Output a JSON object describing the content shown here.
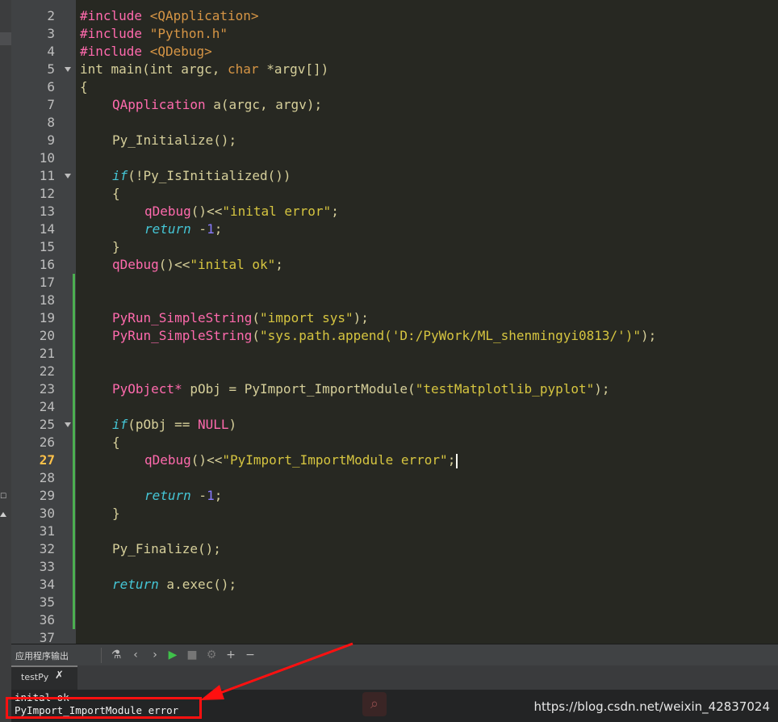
{
  "editor": {
    "current_line": 27,
    "lines": [
      {
        "n": "2",
        "fold": false,
        "mod": false,
        "tokens": [
          [
            "pp",
            "#include "
          ],
          [
            "inc",
            "<QApplication>"
          ]
        ]
      },
      {
        "n": "3",
        "fold": false,
        "mod": false,
        "tokens": [
          [
            "pp",
            "#include "
          ],
          [
            "inc",
            "\"Python.h\""
          ]
        ]
      },
      {
        "n": "4",
        "fold": false,
        "mod": false,
        "tokens": [
          [
            "pp",
            "#include "
          ],
          [
            "inc",
            "<QDebug>"
          ]
        ]
      },
      {
        "n": "5",
        "fold": true,
        "mod": false,
        "tokens": [
          [
            "plain",
            "int main(int argc, "
          ],
          [
            "inc",
            "char"
          ],
          [
            "plain",
            " *argv[])"
          ]
        ]
      },
      {
        "n": "6",
        "fold": false,
        "mod": false,
        "tokens": [
          [
            "plain",
            "{"
          ]
        ]
      },
      {
        "n": "7",
        "fold": false,
        "mod": false,
        "indent": 1,
        "tokens": [
          [
            "fn",
            "QApplication"
          ],
          [
            "plain",
            " a(argc, argv);"
          ]
        ]
      },
      {
        "n": "8",
        "fold": false,
        "mod": false,
        "tokens": []
      },
      {
        "n": "9",
        "fold": false,
        "mod": false,
        "indent": 1,
        "tokens": [
          [
            "plain",
            "Py_Initialize();"
          ]
        ]
      },
      {
        "n": "10",
        "fold": false,
        "mod": false,
        "tokens": []
      },
      {
        "n": "11",
        "fold": true,
        "mod": false,
        "indent": 1,
        "tokens": [
          [
            "kw",
            "if"
          ],
          [
            "plain",
            "(!Py_IsInitialized())"
          ]
        ]
      },
      {
        "n": "12",
        "fold": false,
        "mod": false,
        "indent": 1,
        "tokens": [
          [
            "plain",
            "{"
          ]
        ]
      },
      {
        "n": "13",
        "fold": false,
        "mod": false,
        "indent": 2,
        "tokens": [
          [
            "fn",
            "qDebug"
          ],
          [
            "plain",
            "()<<"
          ],
          [
            "str",
            "\"inital error\""
          ],
          [
            "plain",
            ";"
          ]
        ]
      },
      {
        "n": "14",
        "fold": false,
        "mod": false,
        "indent": 2,
        "tokens": [
          [
            "kw",
            "return"
          ],
          [
            "plain",
            " -"
          ],
          [
            "num",
            "1"
          ],
          [
            "plain",
            ";"
          ]
        ]
      },
      {
        "n": "15",
        "fold": false,
        "mod": false,
        "indent": 1,
        "tokens": [
          [
            "plain",
            "}"
          ]
        ]
      },
      {
        "n": "16",
        "fold": false,
        "mod": false,
        "indent": 1,
        "tokens": [
          [
            "fn",
            "qDebug"
          ],
          [
            "plain",
            "()<<"
          ],
          [
            "str",
            "\"inital ok\""
          ],
          [
            "plain",
            ";"
          ]
        ]
      },
      {
        "n": "17",
        "fold": false,
        "mod": true,
        "tokens": []
      },
      {
        "n": "18",
        "fold": false,
        "mod": true,
        "tokens": []
      },
      {
        "n": "19",
        "fold": false,
        "mod": true,
        "indent": 1,
        "tokens": [
          [
            "fn",
            "PyRun_SimpleString"
          ],
          [
            "plain",
            "("
          ],
          [
            "str",
            "\"import sys\""
          ],
          [
            "plain",
            ");"
          ]
        ]
      },
      {
        "n": "20",
        "fold": false,
        "mod": true,
        "indent": 1,
        "tokens": [
          [
            "fn",
            "PyRun_SimpleString"
          ],
          [
            "plain",
            "("
          ],
          [
            "str",
            "\"sys.path.append('D:/PyWork/ML_shenmingyi0813/')\""
          ],
          [
            "plain",
            ");"
          ]
        ]
      },
      {
        "n": "21",
        "fold": false,
        "mod": true,
        "tokens": []
      },
      {
        "n": "22",
        "fold": false,
        "mod": true,
        "tokens": []
      },
      {
        "n": "23",
        "fold": false,
        "mod": true,
        "indent": 1,
        "tokens": [
          [
            "fn",
            "PyObject*"
          ],
          [
            "plain",
            " pObj = PyImport_ImportModule("
          ],
          [
            "str",
            "\"testMatplotlib_pyplot\""
          ],
          [
            "plain",
            ");"
          ]
        ]
      },
      {
        "n": "24",
        "fold": false,
        "mod": true,
        "tokens": []
      },
      {
        "n": "25",
        "fold": true,
        "mod": true,
        "indent": 1,
        "tokens": [
          [
            "kw",
            "if"
          ],
          [
            "plain",
            "(pObj == "
          ],
          [
            "fn",
            "NULL"
          ],
          [
            "plain",
            ")"
          ]
        ]
      },
      {
        "n": "26",
        "fold": false,
        "mod": true,
        "indent": 1,
        "tokens": [
          [
            "plain",
            "{"
          ]
        ]
      },
      {
        "n": "27",
        "fold": false,
        "mod": true,
        "indent": 2,
        "caret": true,
        "tokens": [
          [
            "fn",
            "qDebug"
          ],
          [
            "plain",
            "()<<"
          ],
          [
            "str",
            "\"PyImport_ImportModule error\""
          ],
          [
            "plain",
            ";"
          ]
        ]
      },
      {
        "n": "28",
        "fold": false,
        "mod": true,
        "tokens": []
      },
      {
        "n": "29",
        "fold": false,
        "mod": true,
        "indent": 2,
        "tokens": [
          [
            "kw",
            "return"
          ],
          [
            "plain",
            " -"
          ],
          [
            "num",
            "1"
          ],
          [
            "plain",
            ";"
          ]
        ]
      },
      {
        "n": "30",
        "fold": false,
        "mod": true,
        "indent": 1,
        "tokens": [
          [
            "plain",
            "}"
          ]
        ]
      },
      {
        "n": "31",
        "fold": false,
        "mod": true,
        "tokens": []
      },
      {
        "n": "32",
        "fold": false,
        "mod": true,
        "indent": 1,
        "tokens": [
          [
            "plain",
            "Py_Finalize();"
          ]
        ]
      },
      {
        "n": "33",
        "fold": false,
        "mod": true,
        "tokens": []
      },
      {
        "n": "34",
        "fold": false,
        "mod": true,
        "indent": 1,
        "tokens": [
          [
            "kw",
            "return"
          ],
          [
            "plain",
            " a.exec();"
          ]
        ]
      },
      {
        "n": "35",
        "fold": false,
        "mod": true,
        "tokens": []
      },
      {
        "n": "36",
        "fold": false,
        "mod": true,
        "tokens": []
      },
      {
        "n": "37",
        "fold": false,
        "mod": false,
        "tokens": []
      }
    ]
  },
  "output_pane": {
    "title": "应用程序输出",
    "tab_label": "testPy",
    "lines": [
      "inital ok",
      "PyImport_ImportModule error"
    ]
  },
  "watermark": "https://blog.csdn.net/weixin_42837024",
  "colors": {
    "highlight_box": "#ff1010",
    "arrow": "#ff1010",
    "gutter_modified": "#4caf50"
  }
}
